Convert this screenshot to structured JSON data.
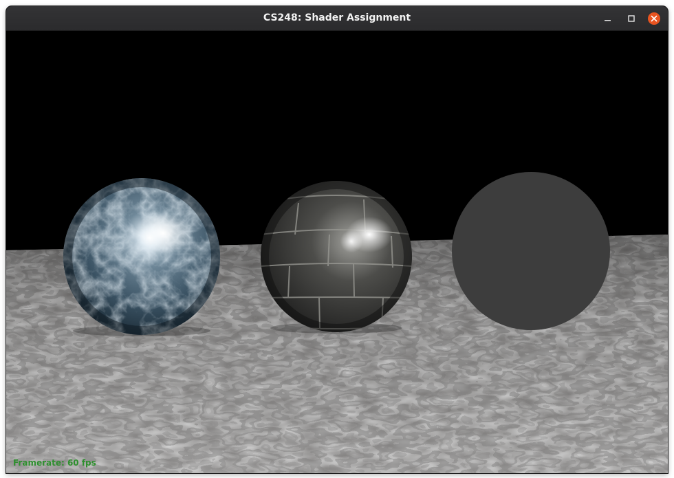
{
  "window": {
    "title": "CS248: Shader Assignment"
  },
  "titlebar": {
    "buttons": [
      {
        "name": "minimize",
        "icon": "minimize-icon"
      },
      {
        "name": "maximize",
        "icon": "maximize-icon"
      },
      {
        "name": "close",
        "icon": "close-icon",
        "color": "#e95420"
      }
    ]
  },
  "scene": {
    "background_color": "#000000",
    "floor_texture": "cobblestone",
    "spheres": [
      {
        "name": "marble-sphere",
        "material": "blue marble",
        "base_color": "#3e5566"
      },
      {
        "name": "brick-sphere",
        "material": "stone brick",
        "base_color": "#4a4a48"
      },
      {
        "name": "flat-sphere",
        "material": "flat gray",
        "base_color": "#3d3d3d"
      }
    ]
  },
  "overlay": {
    "framerate_text": "Framerate: 60 fps",
    "framerate_color": "#2e8f2e"
  }
}
